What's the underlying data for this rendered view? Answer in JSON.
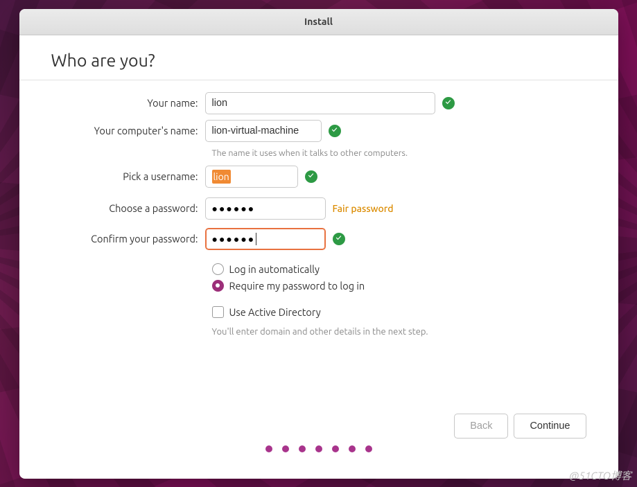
{
  "window": {
    "title": "Install"
  },
  "heading": "Who are you?",
  "fields": {
    "name": {
      "label": "Your name:",
      "value": "lion",
      "valid": true
    },
    "computer": {
      "label": "Your computer's name:",
      "value": "lion-virtual-machine",
      "hint": "The name it uses when it talks to other computers.",
      "valid": true
    },
    "username": {
      "label": "Pick a username:",
      "value": "lion",
      "valid": true,
      "highlighted": true
    },
    "password": {
      "label": "Choose a password:",
      "value": "●●●●●●",
      "strength": "Fair password",
      "strength_color": "#db8b00"
    },
    "confirm": {
      "label": "Confirm your password:",
      "value": "●●●●●●",
      "valid": true,
      "focused": true
    }
  },
  "login_options": {
    "auto": {
      "label": "Log in automatically",
      "checked": false
    },
    "require": {
      "label": "Require my password to log in",
      "checked": true
    }
  },
  "active_directory": {
    "label": "Use Active Directory",
    "checked": false,
    "hint": "You'll enter domain and other details in the next step."
  },
  "buttons": {
    "back": "Back",
    "continue": "Continue"
  },
  "progress_dots": 7,
  "watermark": "@51CTO博客"
}
